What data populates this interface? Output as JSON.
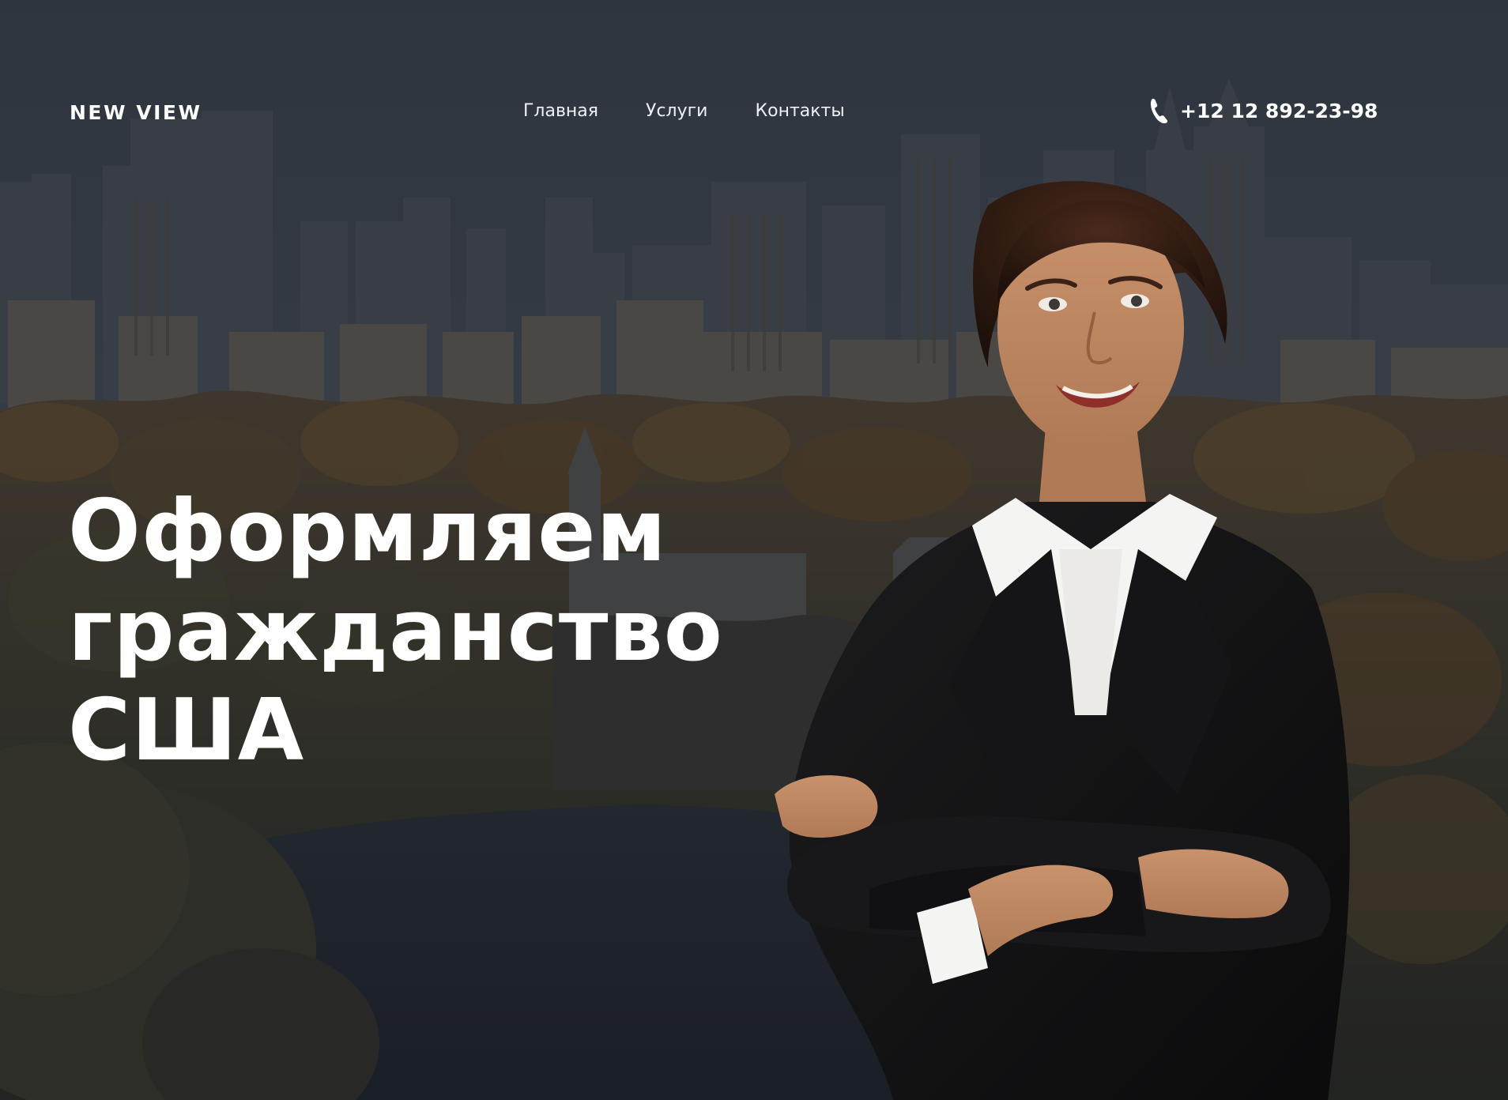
{
  "header": {
    "logo": "NEW VIEW",
    "nav": [
      {
        "label": "Главная"
      },
      {
        "label": "Услуги"
      },
      {
        "label": "Контакты"
      }
    ],
    "phone": {
      "icon": "phone-icon",
      "number": "+12 12 892-23-98"
    }
  },
  "hero": {
    "title_lines": [
      "Оформляем",
      "гражданство",
      "США"
    ],
    "background": "city-park-skyline-photo",
    "portrait": "businesswoman-arms-crossed-photo"
  },
  "colors": {
    "text": "#ffffff",
    "overlay": "#161a21",
    "jacket": "#111111",
    "shirt": "#f4f4f2"
  }
}
